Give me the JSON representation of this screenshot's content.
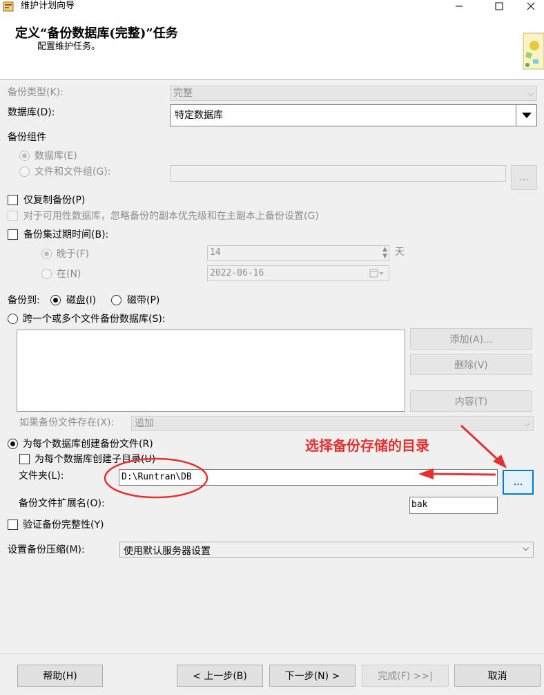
{
  "window": {
    "title": "维护计划向导",
    "icon": "app-icon",
    "controls": [
      "minimize-icon",
      "maximize-icon",
      "close-icon"
    ]
  },
  "header": {
    "title": "定义“备份数据库(完整)”任务",
    "subtitle": "配置维护任务。"
  },
  "backup_type": {
    "label": "备份类型(K):",
    "value": "完整"
  },
  "database": {
    "label": "数据库(D):",
    "value": "特定数据库"
  },
  "backup_component": {
    "label": "备份组件",
    "option_database": "数据库(E)",
    "option_files": "文件和文件组(G):",
    "browse": "..."
  },
  "copy_only": {
    "label": "仅复制备份(P)",
    "checked": false
  },
  "availability": {
    "label": "对于可用性数据库，忽略备份的副本优先级和在主副本上备份设置(G)",
    "checked": false
  },
  "expiry": {
    "label": "备份集过期时间(B):",
    "checked": false,
    "after_label": "晚于(F)",
    "after_value": "14",
    "after_unit": "天",
    "on_label": "在(N)",
    "on_value": "2022-06-16"
  },
  "backup_to": {
    "label": "备份到:",
    "disk": "磁盘(I)",
    "tape": "磁带(P)",
    "selected": "disk"
  },
  "span_files": {
    "label": "跨一个或多个文件备份数据库(S):",
    "add": "添加(A)...",
    "remove": "删除(V)",
    "contents": "内容(T)"
  },
  "if_exists": {
    "label": "如果备份文件存在(X):",
    "value": "追加"
  },
  "per_db_file": {
    "label": "为每个数据库创建备份文件(R)",
    "subdir_label": "为每个数据库创建子目录(U)",
    "folder_label": "文件夹(L):",
    "folder_value": "D:\\Runtran\\DB",
    "browse": "...",
    "ext_label": "备份文件扩展名(O):",
    "ext_value": "bak"
  },
  "verify": {
    "label": "验证备份完整性(Y)",
    "checked": false
  },
  "compression": {
    "label": "设置备份压缩(M):",
    "value": "使用默认服务器设置"
  },
  "annotation": {
    "text": "选择备份存储的目录",
    "color": "#e53030"
  },
  "footer": {
    "help": "帮助(H)",
    "back": "< 上一步(B)",
    "next": "下一步(N) >",
    "finish": "完成(F) >>|",
    "cancel": "取消"
  }
}
